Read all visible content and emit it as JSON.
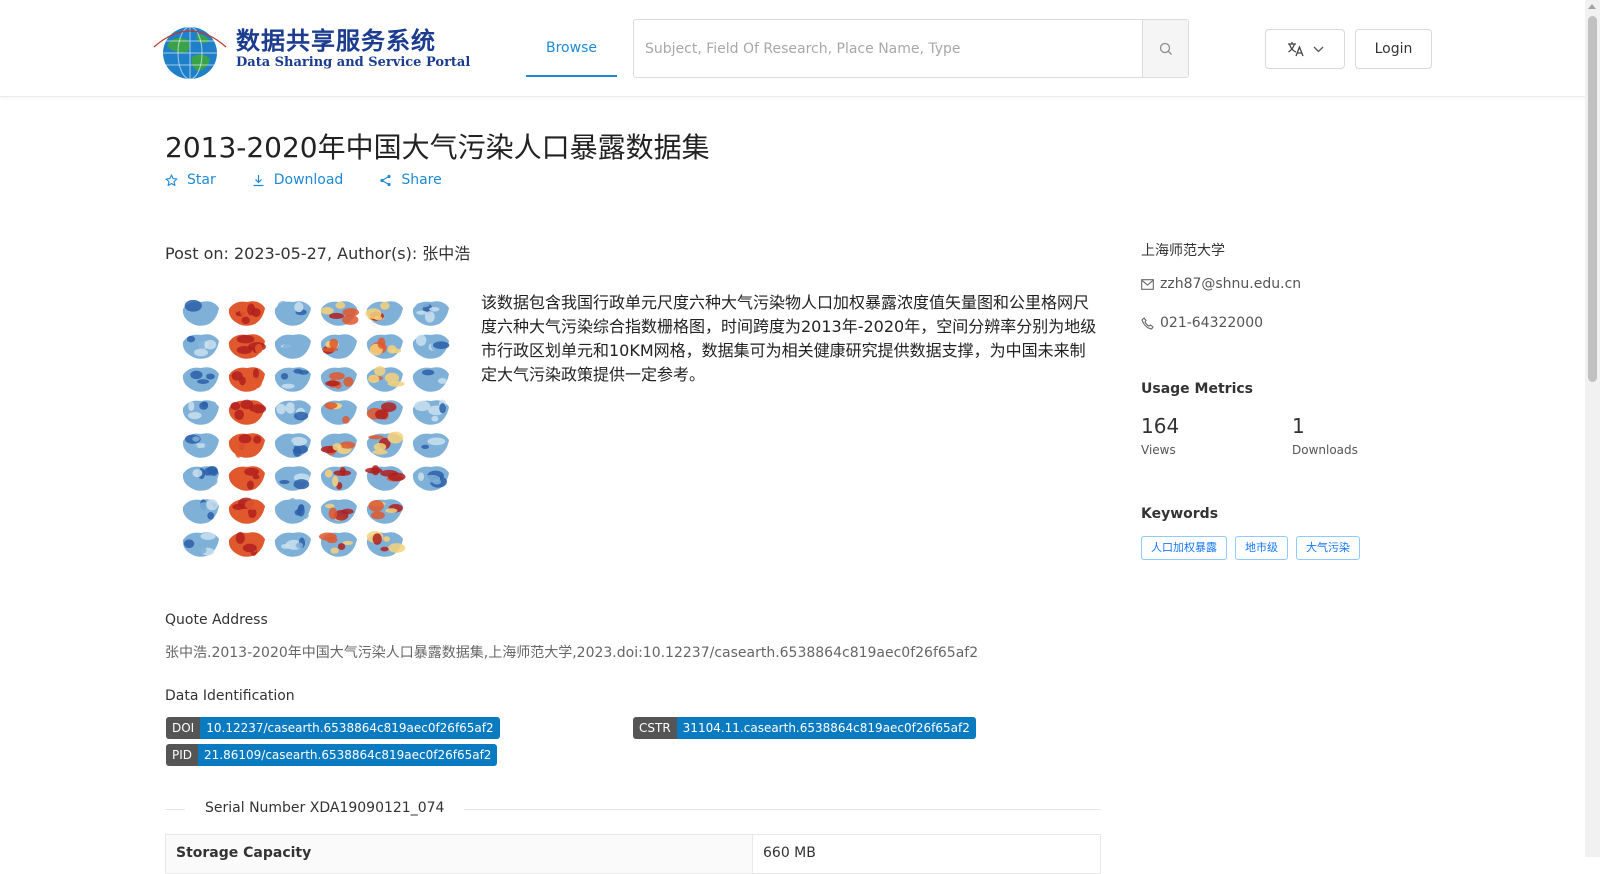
{
  "header": {
    "logo_cn": "数据共享服务系统",
    "logo_en": "Data Sharing and Service Portal",
    "nav_browse": "Browse",
    "search_placeholder": "Subject, Field Of Research, Place Name, Type",
    "login_label": "Login"
  },
  "dataset": {
    "title": "2013-2020年中国大气污染人口暴露数据集",
    "actions": {
      "star": "Star",
      "download": "Download",
      "share": "Share"
    },
    "post_on": "Post on: 2023-05-27, Author(s): 张中浩",
    "description": "该数据包含我国行政单元尺度六种大气污染物人口加权暴露浓度值矢量图和公里格网尺度六种大气污染综合指数栅格图，时间跨度为2013年-2020年，空间分辨率分别为地级市行政区划单元和10KM网格，数据集可为相关健康研究提供数据支撑，为中国未来制定大气污染政策提供一定参考。",
    "quote_label": "Quote Address",
    "quote_text": "张中浩.2013-2020年中国大气污染人口暴露数据集,上海师范大学,2023.doi:10.12237/casearth.6538864c819aec0f26f65af2",
    "identification_label": "Data Identification",
    "ids": {
      "doi_key": "DOI",
      "doi_value": "10.12237/casearth.6538864c819aec0f26f65af2",
      "cstr_key": "CSTR",
      "cstr_value": "31104.11.casearth.6538864c819aec0f26f65af2",
      "pid_key": "PID",
      "pid_value": "21.86109/casearth.6538864c819aec0f26f65af2"
    },
    "serial_number": "Serial Number XDA19090121_074",
    "storage_label": "Storage Capacity",
    "storage_value": "660 MB"
  },
  "sidebar": {
    "organization": "上海师范大学",
    "email": "zzh87@shnu.edu.cn",
    "phone": "021-64322000",
    "metrics_title": "Usage Metrics",
    "views_value": "164",
    "views_label": "Views",
    "downloads_value": "1",
    "downloads_label": "Downloads",
    "keywords_title": "Keywords",
    "keywords": [
      "人口加权暴露",
      "地市级",
      "大气污染"
    ]
  },
  "colors": {
    "accent": "#1e8ad6",
    "badge_value": "#0a7bc1",
    "badge_key": "#555555",
    "logo_blue": "#1b3c8f"
  },
  "icons": [
    "search-icon",
    "translate-icon",
    "chevron-down-icon",
    "star-icon",
    "download-icon",
    "share-icon",
    "mail-icon",
    "phone-icon"
  ]
}
